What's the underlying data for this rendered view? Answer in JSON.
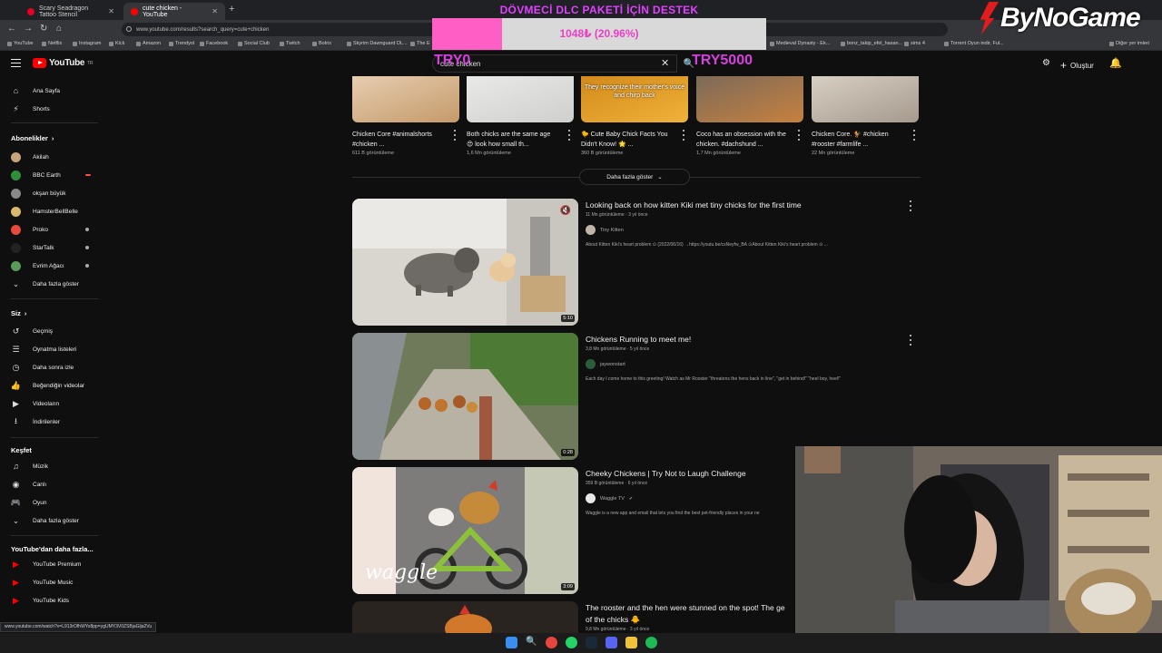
{
  "browser": {
    "tabs": [
      {
        "title": "Scary Seadragon Tattoo Stencil",
        "active": false
      },
      {
        "title": "cute chicken - YouTube",
        "active": true
      }
    ],
    "url": "www.youtube.com/results?search_query=cute+chicken",
    "bookmarks": [
      "YouTube",
      "Netflix",
      "Instagram",
      "Kick",
      "Amazon",
      "Trendyol",
      "Facebook",
      "Social Club",
      "Twitch",
      "Botrix",
      "Skyrim Dawnguard DL...",
      "The E",
      "Medieval Dynasty - Ek...",
      "bonz_takip_efel_hasan...",
      "sims 4",
      "Torrent Oyun indir, Ful...",
      "Diğer yer imleri"
    ],
    "status_url": "www.youtube.com/watch?v=L913rOfhWYo8pp=ygUMY3V0ZSBjaGlja2Vu"
  },
  "overlay": {
    "title": "DÖVMECİ DLC PAKETİ İÇİN DESTEK",
    "progress_label": "1048₺ (20.96%)",
    "progress_fraction": 0.2096,
    "goal_left": "TRY0",
    "goal_right": "TRY5000",
    "brand": "ByNoGame"
  },
  "youtube": {
    "logo": "YouTube",
    "logo_country": "TR",
    "search_value": "cute chicken",
    "create_label": "Oluştur",
    "sidebar": {
      "main": [
        {
          "label": "Ana Sayfa",
          "icon": "home-icon",
          "glyph": "⌂"
        },
        {
          "label": "Shorts",
          "icon": "shorts-icon",
          "glyph": "⚡"
        }
      ],
      "subscriptions_title": "Abonelikler",
      "subscriptions": [
        {
          "label": "Akilah",
          "color": "#c8a27a",
          "live": "none"
        },
        {
          "label": "BBC Earth",
          "color": "#2f8f3b",
          "live": "red"
        },
        {
          "label": "okşan büyük",
          "color": "#8a8a8a",
          "live": "none"
        },
        {
          "label": "HamsterBellBelle",
          "color": "#d8b86b",
          "live": "none"
        },
        {
          "label": "Proko",
          "color": "#e84a3b",
          "live": "dot"
        },
        {
          "label": "StarTalk",
          "color": "#222222",
          "live": "dot"
        },
        {
          "label": "Evrim Ağacı",
          "color": "#5a9b5a",
          "live": "dot"
        }
      ],
      "show_more": "Daha fazla göster",
      "you_title": "Siz",
      "you": [
        {
          "label": "Geçmiş",
          "icon": "history-icon",
          "glyph": "↺"
        },
        {
          "label": "Oynatma listeleri",
          "icon": "playlists-icon",
          "glyph": "☰"
        },
        {
          "label": "Daha sonra izle",
          "icon": "watch-later-icon",
          "glyph": "◷"
        },
        {
          "label": "Beğendiğin videolar",
          "icon": "liked-videos-icon",
          "glyph": "👍"
        },
        {
          "label": "Videoların",
          "icon": "your-videos-icon",
          "glyph": "▶"
        },
        {
          "label": "İndirilenler",
          "icon": "downloads-icon",
          "glyph": "⭳"
        }
      ],
      "explore_title": "Keşfet",
      "explore": [
        {
          "label": "Müzik",
          "icon": "music-icon",
          "glyph": "♫"
        },
        {
          "label": "Canlı",
          "icon": "live-icon",
          "glyph": "◉"
        },
        {
          "label": "Oyun",
          "icon": "gaming-icon",
          "glyph": "🎮"
        }
      ],
      "explore_more": "Daha fazla göster",
      "more_title": "YouTube'dan daha fazla...",
      "more": [
        {
          "label": "YouTube Premium",
          "icon": "youtube-premium-icon"
        },
        {
          "label": "YouTube Music",
          "icon": "youtube-music-icon"
        },
        {
          "label": "YouTube Kids",
          "icon": "youtube-kids-icon"
        }
      ]
    },
    "shorts": [
      {
        "title": "Chicken Core #animalshorts #chicken ...",
        "views": "611 B görüntüleme",
        "overlay": ""
      },
      {
        "title": "Both chicks are the same age 😍 look how small th...",
        "views": "1,6 Mn görüntüleme",
        "overlay": ""
      },
      {
        "title": "🐤 Cute Baby Chick Facts You Didn't Know! 🌟 ...",
        "views": "360 B görüntüleme",
        "overlay": "They recognize their mother's voice and chirp back"
      },
      {
        "title": "Coco has an obsession with the chicken. #dachshund ...",
        "views": "1,7 Mn görüntüleme",
        "overlay": ""
      },
      {
        "title": "Chicken Core. 🐓 #chicken #rooster #farmlife ...",
        "views": "22 Mn görüntüleme",
        "overlay": ""
      }
    ],
    "shorts_more": "Daha fazla göster",
    "videos": [
      {
        "title": "Looking back on how kitten Kiki met tiny chicks for the first time",
        "meta": "11 Mn görüntüleme · 3 yıl önce",
        "channel": "Tiny Kitten",
        "verified": false,
        "desc": "About Kitten Kiki's heart problem ⊙ (2022/06/16) →https://youtu.be/csNeyfw_BA ⊙About Kitten Kiki's heart problem ⊙ ...",
        "duration": "5:10"
      },
      {
        "title": "Chickens Running to meet me!",
        "meta": "3,8 Mn görüntüleme · 5 yıl önce",
        "channel": "jaywonstart",
        "verified": false,
        "desc": "Each day I come home to this greeting! Watch as Mr Rooster \"threatens the hens back in line\", \"get in behind!\" \"heel boy, heel!\"",
        "duration": "0:28"
      },
      {
        "title": "Cheeky Chickens | Try Not to Laugh Challenge",
        "meta": "359 B görüntüleme · 6 yıl önce",
        "channel": "Waggle TV",
        "verified": true,
        "desc": "Waggle is a new app and email that lets you find the best pet-friendly places in your ne",
        "duration": "3:09",
        "thumb_text": "waggle"
      },
      {
        "title": "The rooster and the hen were stunned on the spot! The ge",
        "title2": "of the chicks 🐥",
        "meta": "9,8 Mn görüntüleme · 3 yıl önce",
        "channel": "",
        "verified": false,
        "desc": "",
        "duration": ""
      }
    ]
  }
}
